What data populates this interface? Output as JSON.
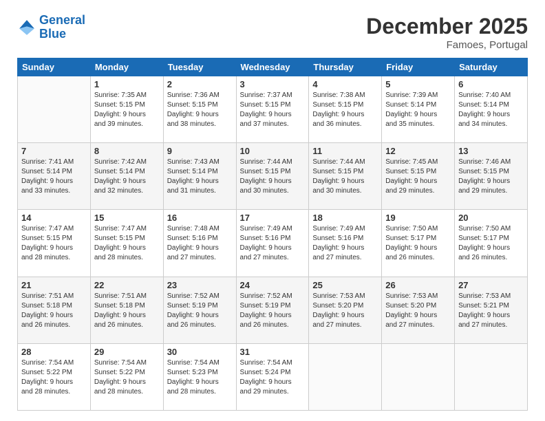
{
  "header": {
    "logo_line1": "General",
    "logo_line2": "Blue",
    "title": "December 2025",
    "subtitle": "Famoes, Portugal"
  },
  "calendar": {
    "columns": [
      "Sunday",
      "Monday",
      "Tuesday",
      "Wednesday",
      "Thursday",
      "Friday",
      "Saturday"
    ],
    "rows": [
      [
        {
          "day": "",
          "info": ""
        },
        {
          "day": "1",
          "info": "Sunrise: 7:35 AM\nSunset: 5:15 PM\nDaylight: 9 hours\nand 39 minutes."
        },
        {
          "day": "2",
          "info": "Sunrise: 7:36 AM\nSunset: 5:15 PM\nDaylight: 9 hours\nand 38 minutes."
        },
        {
          "day": "3",
          "info": "Sunrise: 7:37 AM\nSunset: 5:15 PM\nDaylight: 9 hours\nand 37 minutes."
        },
        {
          "day": "4",
          "info": "Sunrise: 7:38 AM\nSunset: 5:15 PM\nDaylight: 9 hours\nand 36 minutes."
        },
        {
          "day": "5",
          "info": "Sunrise: 7:39 AM\nSunset: 5:14 PM\nDaylight: 9 hours\nand 35 minutes."
        },
        {
          "day": "6",
          "info": "Sunrise: 7:40 AM\nSunset: 5:14 PM\nDaylight: 9 hours\nand 34 minutes."
        }
      ],
      [
        {
          "day": "7",
          "info": "Sunrise: 7:41 AM\nSunset: 5:14 PM\nDaylight: 9 hours\nand 33 minutes."
        },
        {
          "day": "8",
          "info": "Sunrise: 7:42 AM\nSunset: 5:14 PM\nDaylight: 9 hours\nand 32 minutes."
        },
        {
          "day": "9",
          "info": "Sunrise: 7:43 AM\nSunset: 5:14 PM\nDaylight: 9 hours\nand 31 minutes."
        },
        {
          "day": "10",
          "info": "Sunrise: 7:44 AM\nSunset: 5:15 PM\nDaylight: 9 hours\nand 30 minutes."
        },
        {
          "day": "11",
          "info": "Sunrise: 7:44 AM\nSunset: 5:15 PM\nDaylight: 9 hours\nand 30 minutes."
        },
        {
          "day": "12",
          "info": "Sunrise: 7:45 AM\nSunset: 5:15 PM\nDaylight: 9 hours\nand 29 minutes."
        },
        {
          "day": "13",
          "info": "Sunrise: 7:46 AM\nSunset: 5:15 PM\nDaylight: 9 hours\nand 29 minutes."
        }
      ],
      [
        {
          "day": "14",
          "info": "Sunrise: 7:47 AM\nSunset: 5:15 PM\nDaylight: 9 hours\nand 28 minutes."
        },
        {
          "day": "15",
          "info": "Sunrise: 7:47 AM\nSunset: 5:15 PM\nDaylight: 9 hours\nand 28 minutes."
        },
        {
          "day": "16",
          "info": "Sunrise: 7:48 AM\nSunset: 5:16 PM\nDaylight: 9 hours\nand 27 minutes."
        },
        {
          "day": "17",
          "info": "Sunrise: 7:49 AM\nSunset: 5:16 PM\nDaylight: 9 hours\nand 27 minutes."
        },
        {
          "day": "18",
          "info": "Sunrise: 7:49 AM\nSunset: 5:16 PM\nDaylight: 9 hours\nand 27 minutes."
        },
        {
          "day": "19",
          "info": "Sunrise: 7:50 AM\nSunset: 5:17 PM\nDaylight: 9 hours\nand 26 minutes."
        },
        {
          "day": "20",
          "info": "Sunrise: 7:50 AM\nSunset: 5:17 PM\nDaylight: 9 hours\nand 26 minutes."
        }
      ],
      [
        {
          "day": "21",
          "info": "Sunrise: 7:51 AM\nSunset: 5:18 PM\nDaylight: 9 hours\nand 26 minutes."
        },
        {
          "day": "22",
          "info": "Sunrise: 7:51 AM\nSunset: 5:18 PM\nDaylight: 9 hours\nand 26 minutes."
        },
        {
          "day": "23",
          "info": "Sunrise: 7:52 AM\nSunset: 5:19 PM\nDaylight: 9 hours\nand 26 minutes."
        },
        {
          "day": "24",
          "info": "Sunrise: 7:52 AM\nSunset: 5:19 PM\nDaylight: 9 hours\nand 26 minutes."
        },
        {
          "day": "25",
          "info": "Sunrise: 7:53 AM\nSunset: 5:20 PM\nDaylight: 9 hours\nand 27 minutes."
        },
        {
          "day": "26",
          "info": "Sunrise: 7:53 AM\nSunset: 5:20 PM\nDaylight: 9 hours\nand 27 minutes."
        },
        {
          "day": "27",
          "info": "Sunrise: 7:53 AM\nSunset: 5:21 PM\nDaylight: 9 hours\nand 27 minutes."
        }
      ],
      [
        {
          "day": "28",
          "info": "Sunrise: 7:54 AM\nSunset: 5:22 PM\nDaylight: 9 hours\nand 28 minutes."
        },
        {
          "day": "29",
          "info": "Sunrise: 7:54 AM\nSunset: 5:22 PM\nDaylight: 9 hours\nand 28 minutes."
        },
        {
          "day": "30",
          "info": "Sunrise: 7:54 AM\nSunset: 5:23 PM\nDaylight: 9 hours\nand 28 minutes."
        },
        {
          "day": "31",
          "info": "Sunrise: 7:54 AM\nSunset: 5:24 PM\nDaylight: 9 hours\nand 29 minutes."
        },
        {
          "day": "",
          "info": ""
        },
        {
          "day": "",
          "info": ""
        },
        {
          "day": "",
          "info": ""
        }
      ]
    ]
  }
}
